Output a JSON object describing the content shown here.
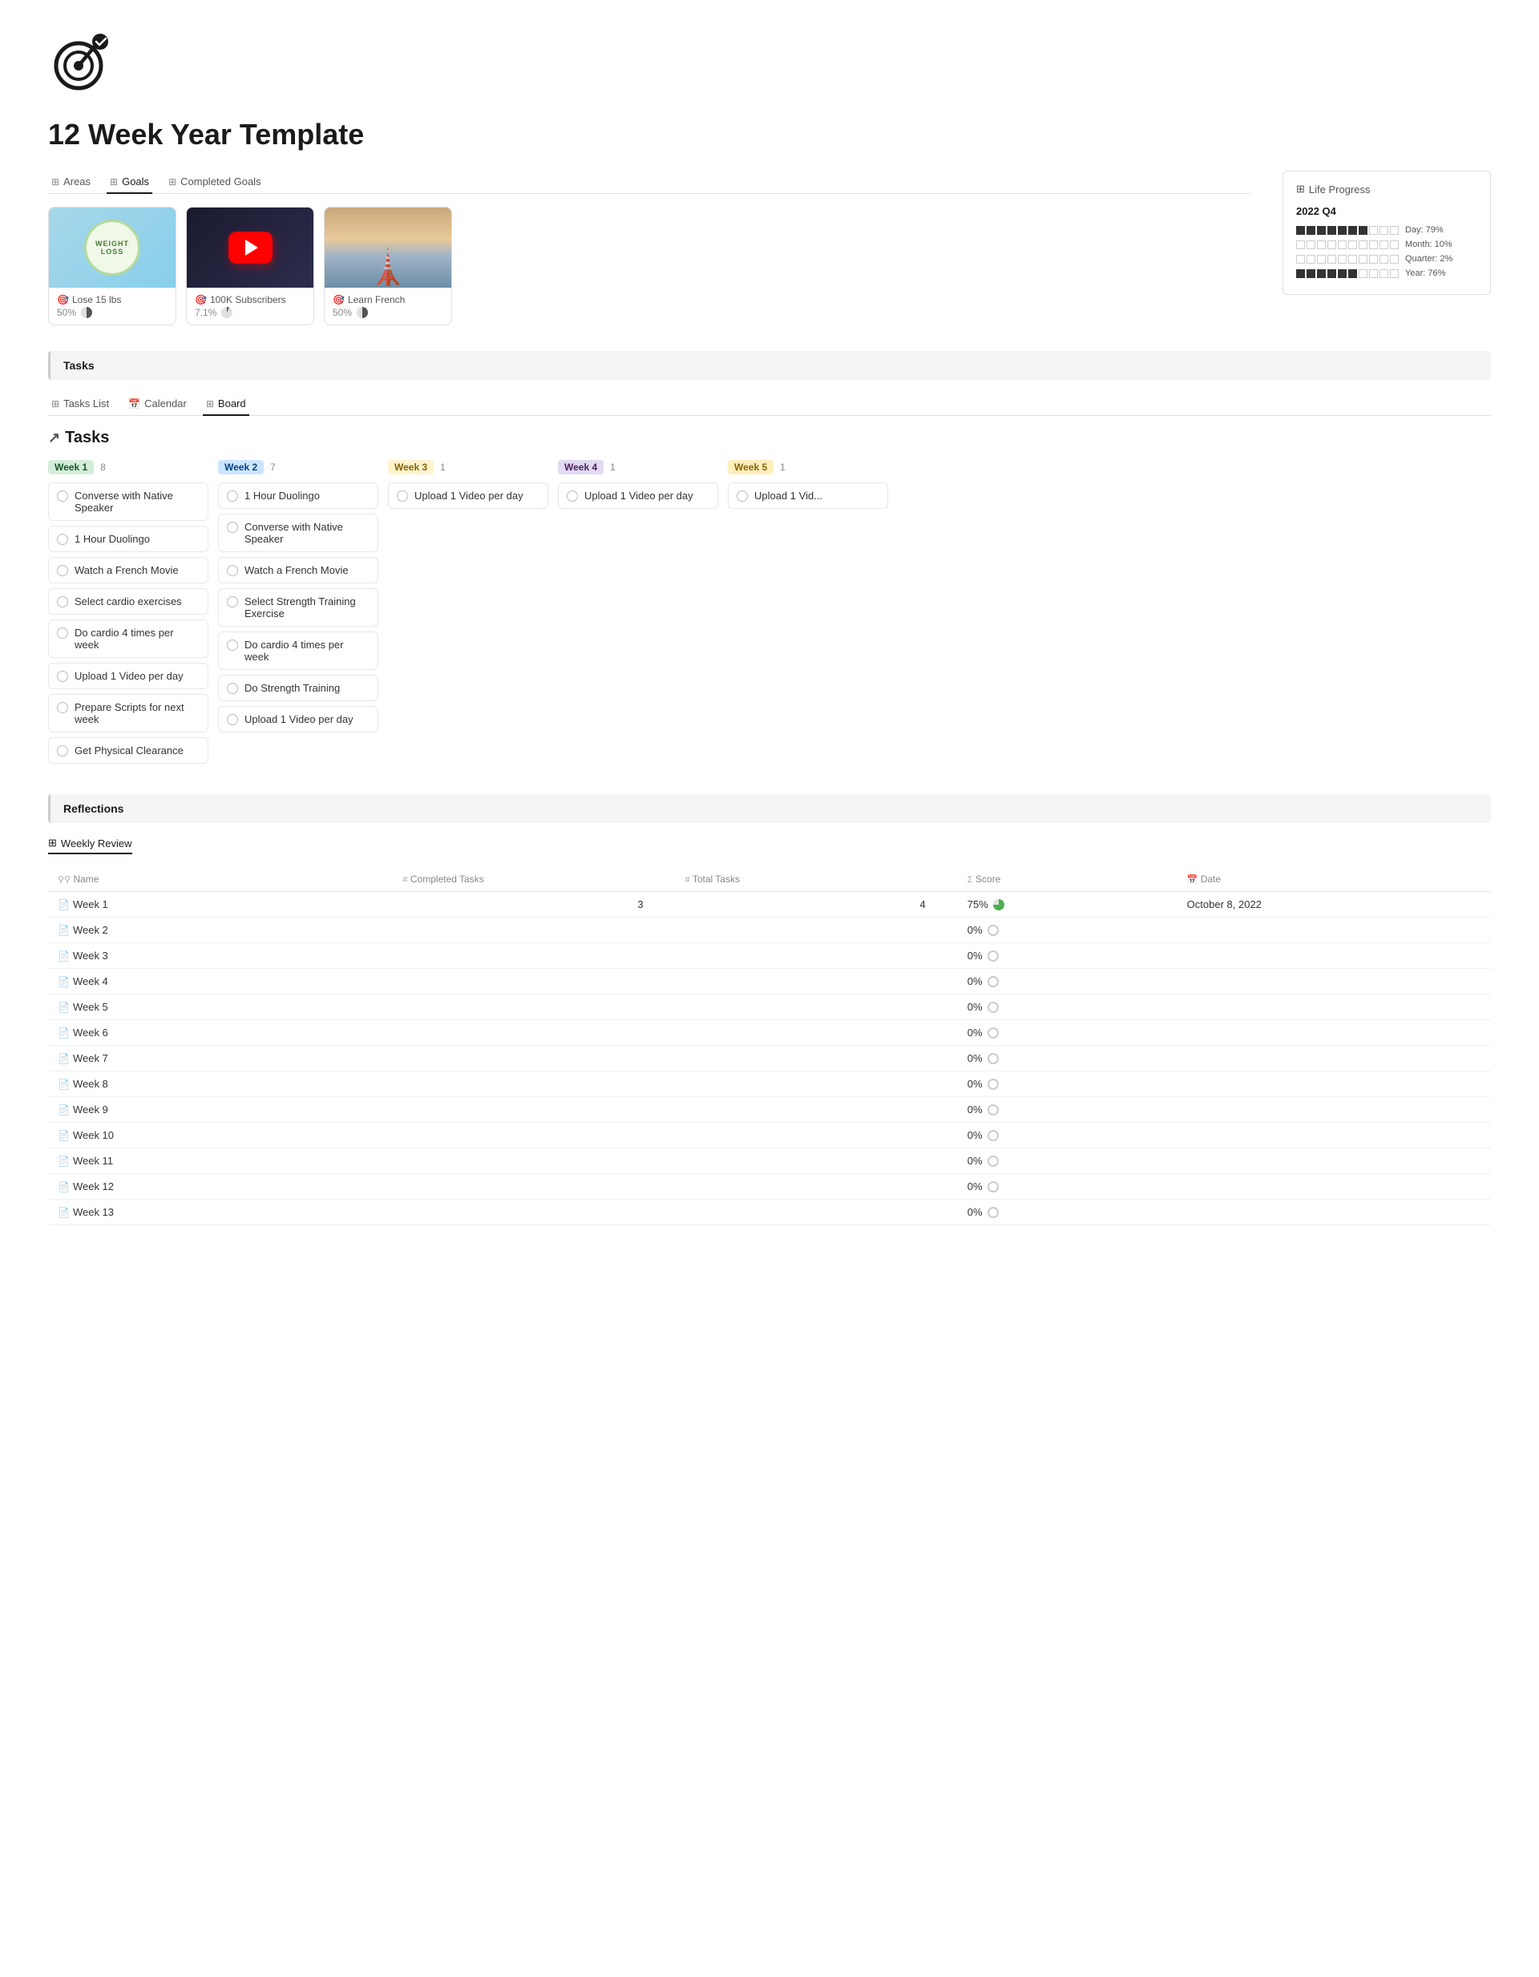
{
  "app": {
    "title": "12 Week Year Template",
    "logo_alt": "Target goal icon"
  },
  "nav_tabs": [
    {
      "label": "Areas",
      "icon": "⊞",
      "active": false
    },
    {
      "label": "Goals",
      "icon": "⊞",
      "active": true
    },
    {
      "label": "Completed Goals",
      "icon": "⊞",
      "active": false
    }
  ],
  "life_progress": {
    "section_icon": "⊞",
    "section_label": "Life Progress",
    "quarter": "2022 Q4",
    "rows": [
      {
        "filled": 7,
        "total": 10,
        "label": "Day: 79%"
      },
      {
        "filled": 1,
        "total": 10,
        "label": "Month: 10%"
      },
      {
        "filled": 0,
        "total": 10,
        "label": "Quarter: 2%"
      },
      {
        "filled": 6,
        "total": 10,
        "label": "Year: 76%"
      }
    ]
  },
  "goals": [
    {
      "name": "Lose 15 lbs",
      "progress": "50%",
      "type": "weight"
    },
    {
      "name": "100K Subscribers",
      "progress": "7.1%",
      "type": "youtube"
    },
    {
      "name": "Learn French",
      "progress": "50%",
      "type": "paris"
    }
  ],
  "tasks_section": {
    "label": "Tasks",
    "sub_tabs": [
      {
        "label": "Tasks List",
        "icon": "⊞",
        "active": false
      },
      {
        "label": "Calendar",
        "icon": "📅",
        "active": false
      },
      {
        "label": "Board",
        "icon": "⊞",
        "active": true
      }
    ],
    "heading": "Tasks",
    "columns": [
      {
        "week": "Week 1",
        "badge_class": "week1",
        "count": "8",
        "tasks": [
          "Converse with Native Speaker",
          "1 Hour Duolingo",
          "Watch a French Movie",
          "Select cardio exercises",
          "Do cardio 4 times per week",
          "Upload 1 Video per day",
          "Prepare Scripts for next week",
          "Get Physical Clearance"
        ]
      },
      {
        "week": "Week 2",
        "badge_class": "week2",
        "count": "7",
        "tasks": [
          "1 Hour Duolingo",
          "Converse with Native Speaker",
          "Watch a French Movie",
          "Select Strength Training Exercise",
          "Do cardio 4 times per week",
          "Do Strength Training",
          "Upload 1 Video per day"
        ]
      },
      {
        "week": "Week 3",
        "badge_class": "week3",
        "count": "1",
        "tasks": [
          "Upload 1 Video per day"
        ]
      },
      {
        "week": "Week 4",
        "badge_class": "week4",
        "count": "1",
        "tasks": [
          "Upload 1 Video per day"
        ]
      },
      {
        "week": "Week 5",
        "badge_class": "week5",
        "count": "1",
        "tasks": [
          "Upload 1 Vid..."
        ]
      }
    ]
  },
  "reflections": {
    "label": "Reflections",
    "tab_icon": "⊞",
    "tab_label": "Weekly Review",
    "columns": {
      "name": "Name",
      "completed_tasks": "Completed Tasks",
      "total_tasks": "Total Tasks",
      "score": "Score",
      "date": "Date"
    },
    "rows": [
      {
        "name": "Week 1",
        "completed_tasks": "3",
        "total_tasks": "4",
        "score": "75%",
        "score_type": "partial",
        "date": "October 8, 2022"
      },
      {
        "name": "Week 2",
        "completed_tasks": "",
        "total_tasks": "",
        "score": "0%",
        "score_type": "empty",
        "date": ""
      },
      {
        "name": "Week 3",
        "completed_tasks": "",
        "total_tasks": "",
        "score": "0%",
        "score_type": "empty",
        "date": ""
      },
      {
        "name": "Week 4",
        "completed_tasks": "",
        "total_tasks": "",
        "score": "0%",
        "score_type": "empty",
        "date": ""
      },
      {
        "name": "Week 5",
        "completed_tasks": "",
        "total_tasks": "",
        "score": "0%",
        "score_type": "empty",
        "date": ""
      },
      {
        "name": "Week 6",
        "completed_tasks": "",
        "total_tasks": "",
        "score": "0%",
        "score_type": "empty",
        "date": ""
      },
      {
        "name": "Week 7",
        "completed_tasks": "",
        "total_tasks": "",
        "score": "0%",
        "score_type": "empty",
        "date": ""
      },
      {
        "name": "Week 8",
        "completed_tasks": "",
        "total_tasks": "",
        "score": "0%",
        "score_type": "empty",
        "date": ""
      },
      {
        "name": "Week 9",
        "completed_tasks": "",
        "total_tasks": "",
        "score": "0%",
        "score_type": "empty",
        "date": ""
      },
      {
        "name": "Week 10",
        "completed_tasks": "",
        "total_tasks": "",
        "score": "0%",
        "score_type": "empty",
        "date": ""
      },
      {
        "name": "Week 11",
        "completed_tasks": "",
        "total_tasks": "",
        "score": "0%",
        "score_type": "empty",
        "date": ""
      },
      {
        "name": "Week 12",
        "completed_tasks": "",
        "total_tasks": "",
        "score": "0%",
        "score_type": "empty",
        "date": ""
      },
      {
        "name": "Week 13",
        "completed_tasks": "",
        "total_tasks": "",
        "score": "0%",
        "score_type": "empty",
        "date": ""
      }
    ]
  }
}
